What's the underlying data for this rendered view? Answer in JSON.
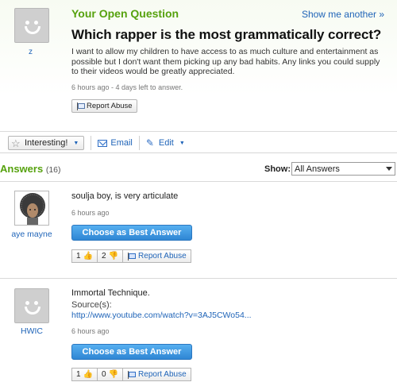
{
  "question": {
    "section_header": "Your Open Question",
    "show_another": "Show me another »",
    "title": "Which rapper is the most grammatically correct?",
    "body": "I want to allow my children to have access to as much culture and entertainment as possible but I don't want them picking up any bad habits. Any links you could supply to their videos would be greatly appreciated.",
    "meta": "6 hours ago - 4 days left to answer.",
    "asker": "z",
    "report_label": "Report Abuse"
  },
  "actions": {
    "interesting": "Interesting!",
    "email": "Email",
    "edit": "Edit"
  },
  "answers_header": {
    "title": "Answers",
    "count": "(16)",
    "show_label": "Show:",
    "filter_value": "All Answers"
  },
  "answers": [
    {
      "user": "aye mayne",
      "text": "soulja boy, is very articulate",
      "meta": "6 hours ago",
      "best_label": "Choose as Best Answer",
      "thumbs_up": "1",
      "thumbs_down": "2",
      "report_label": "Report Abuse"
    },
    {
      "user": "HWIC",
      "text": "Immortal Technique.",
      "source_label": "Source(s):",
      "source_link": "http://www.youtube.com/watch?v=3AJ5CWo54...",
      "meta": "6 hours ago",
      "best_label": "Choose as Best Answer",
      "thumbs_up": "1",
      "thumbs_down": "0",
      "report_label": "Report Abuse"
    }
  ],
  "icons": {
    "avatar": "default-avatar-icon",
    "flag": "flag-icon",
    "star": "star-icon",
    "mail": "mail-icon",
    "pencil": "pencil-icon",
    "thumbs_up": "thumbs-up-icon",
    "thumbs_down": "thumbs-down-icon"
  },
  "colors": {
    "accent_green": "#56a20e",
    "link_blue": "#1f64b8",
    "button_blue": "#2f86d4"
  }
}
